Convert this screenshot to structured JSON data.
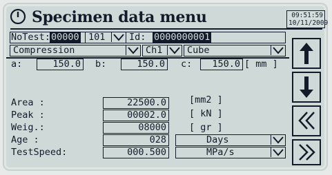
{
  "header": {
    "title": "Specimen data menu",
    "time": "09:51:59",
    "date": "10/11/2009",
    "clock_icon": "clock-icon"
  },
  "row1": {
    "notest_label": "NoTest:",
    "notest_value": "00000",
    "notest_ext": "101",
    "id_label": "Id:",
    "id_value": "0000000001"
  },
  "row2": {
    "test_type": "Compression",
    "channel": "Ch1",
    "shape": "Cube"
  },
  "dims": {
    "a_label": "a:",
    "a_value": "150.0",
    "b_label": "b:",
    "b_value": "150.0",
    "c_label": "c:",
    "c_value": "150.0",
    "unit": "[ mm ]"
  },
  "fields": {
    "area_label": "Area :",
    "area_value": "22500.0",
    "area_unit": "[mm2 ]",
    "peak_label": "Peak :",
    "peak_value": "00002.0",
    "peak_unit": "[ kN ]",
    "weig_label": "Weig.:",
    "weig_value": "08000",
    "weig_unit": "[ gr ]",
    "age_label": "Age :",
    "age_value": "028",
    "age_unit": "Days",
    "speed_label": "TestSpeed:",
    "speed_value": "000.500",
    "speed_unit": "MPa/s"
  },
  "buttons": [
    "arrow-up-icon",
    "arrow-down-icon",
    "double-chevron-left-icon",
    "double-chevron-right-icon"
  ],
  "colors": {
    "lcd_background": "#cfdad8",
    "ink": "#131a2a"
  }
}
